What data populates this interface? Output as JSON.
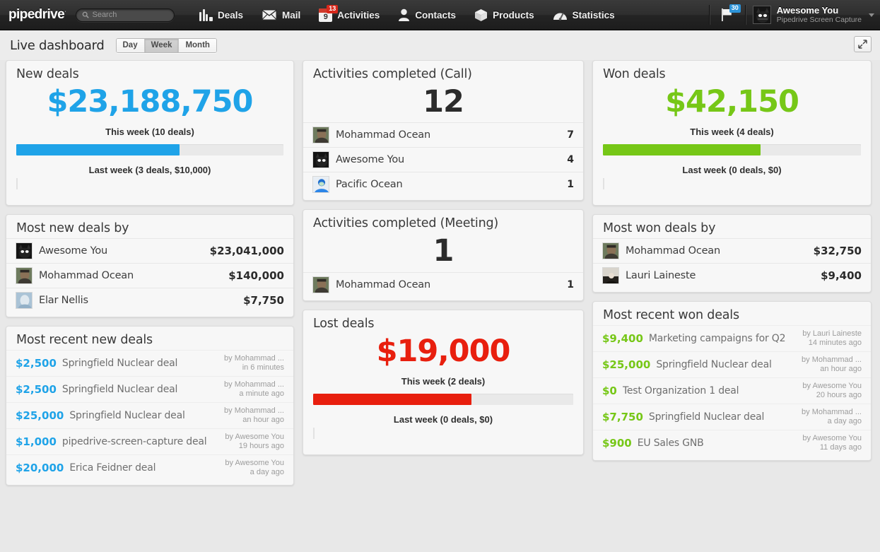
{
  "topnav": {
    "brand": "pipedrive",
    "brand_tm": "·",
    "search_placeholder": "Search",
    "items": [
      {
        "label": "Deals",
        "icon": "deals-bars-icon"
      },
      {
        "label": "Mail",
        "icon": "envelope-icon"
      },
      {
        "label": "Activities",
        "icon": "calendar-icon",
        "calendar_day": "9",
        "badge": "13"
      },
      {
        "label": "Contacts",
        "icon": "person-icon"
      },
      {
        "label": "Products",
        "icon": "box-icon"
      },
      {
        "label": "Statistics",
        "icon": "gauge-icon"
      }
    ],
    "flag_badge": "30",
    "user": {
      "name": "Awesome You",
      "company": "Pipedrive Screen Capture"
    }
  },
  "dashboard": {
    "title": "Live dashboard",
    "ranges": [
      {
        "label": "Day",
        "active": false
      },
      {
        "label": "Week",
        "active": true
      },
      {
        "label": "Month",
        "active": false
      }
    ],
    "expand_icon": "expand-arrows-icon"
  },
  "colors": {
    "new_deals": "#1fa3e8",
    "won_deals": "#76c717",
    "lost_deals": "#e81f0e",
    "neutral_dark": "#2b2b2b",
    "badge_red": "#d8281b",
    "badge_blue": "#2c93d8"
  },
  "panels": {
    "new_deals": {
      "title": "New deals",
      "value": "$23,188,750",
      "this_week": "This week (10 deals)",
      "last_week": "Last week (3 deals, $10,000)",
      "bar_percent": 61,
      "color": "#1fa3e8"
    },
    "most_new_deals_by": {
      "title": "Most new deals by",
      "rows": [
        {
          "name": "Awesome You",
          "value": "$23,041,000",
          "avatar": "cat-avatar"
        },
        {
          "name": "Mohammad Ocean",
          "value": "$140,000",
          "avatar": "man-avatar"
        },
        {
          "name": "Elar Nellis",
          "value": "$7,750",
          "avatar": "face-avatar"
        }
      ]
    },
    "most_recent_new_deals": {
      "title": "Most recent new deals",
      "rows": [
        {
          "amount": "$2,500",
          "title": "Springfield Nuclear deal",
          "by": "by Mohammad ...",
          "when": "in 6 minutes"
        },
        {
          "amount": "$2,500",
          "title": "Springfield Nuclear deal",
          "by": "by Mohammad ...",
          "when": "a minute ago"
        },
        {
          "amount": "$25,000",
          "title": "Springfield Nuclear deal",
          "by": "by Mohammad ...",
          "when": "an hour ago"
        },
        {
          "amount": "$1,000",
          "title": "pipedrive-screen-capture deal",
          "by": "by Awesome You",
          "when": "19 hours ago"
        },
        {
          "amount": "$20,000",
          "title": "Erica Feidner deal",
          "by": "by Awesome You",
          "when": "a day ago"
        }
      ]
    },
    "activities_call": {
      "title": "Activities completed (Call)",
      "value": "12",
      "rows": [
        {
          "name": "Mohammad Ocean",
          "value": "7",
          "avatar": "man-avatar"
        },
        {
          "name": "Awesome You",
          "value": "4",
          "avatar": "cat-avatar"
        },
        {
          "name": "Pacific Ocean",
          "value": "1",
          "avatar": "blue-person-avatar"
        }
      ]
    },
    "activities_meeting": {
      "title": "Activities completed (Meeting)",
      "value": "1",
      "rows": [
        {
          "name": "Mohammad Ocean",
          "value": "1",
          "avatar": "man-avatar"
        }
      ]
    },
    "lost_deals": {
      "title": "Lost deals",
      "value": "$19,000",
      "this_week": "This week (2 deals)",
      "last_week": "Last week (0 deals, $0)",
      "bar_percent": 61,
      "color": "#e81f0e"
    },
    "won_deals": {
      "title": "Won deals",
      "value": "$42,150",
      "this_week": "This week (4 deals)",
      "last_week": "Last week (0 deals, $0)",
      "bar_percent": 61,
      "color": "#76c717"
    },
    "most_won_deals_by": {
      "title": "Most won deals by",
      "rows": [
        {
          "name": "Mohammad Ocean",
          "value": "$32,750",
          "avatar": "man-avatar"
        },
        {
          "name": "Lauri Laineste",
          "value": "$9,400",
          "avatar": "photo-avatar"
        }
      ]
    },
    "most_recent_won_deals": {
      "title": "Most recent won deals",
      "rows": [
        {
          "amount": "$9,400",
          "title": "Marketing campaigns for Q2",
          "by": "by Lauri Laineste",
          "when": "14 minutes ago"
        },
        {
          "amount": "$25,000",
          "title": "Springfield Nuclear deal",
          "by": "by Mohammad ...",
          "when": "an hour ago"
        },
        {
          "amount": "$0",
          "title": "Test Organization 1 deal",
          "by": "by Awesome You",
          "when": "20 hours ago"
        },
        {
          "amount": "$7,750",
          "title": "Springfield Nuclear deal",
          "by": "by Mohammad ...",
          "when": "a day ago"
        },
        {
          "amount": "$900",
          "title": "EU Sales GNB",
          "by": "by Awesome You",
          "when": "11 days ago"
        }
      ]
    }
  }
}
